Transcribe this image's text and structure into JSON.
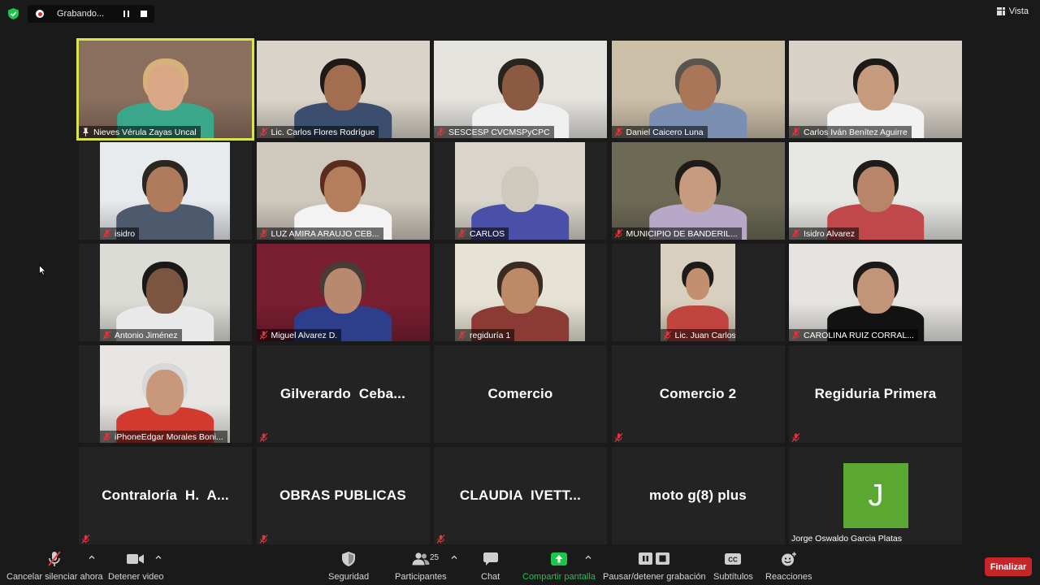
{
  "recording": {
    "label": "Grabando..."
  },
  "view": {
    "label": "Vista"
  },
  "tiles": [
    {
      "name": "Nieves Vérula Zayas Uncal",
      "icon": "pin-icon",
      "bg": "#8a6f5e",
      "skin": "#d9a686",
      "hair": "#d6b27a",
      "shirt": "#3aa68a"
    },
    {
      "name": "Lic. Carlos Flores Rodrígue",
      "icon": "mic-muted-icon",
      "bg": "#d9d3c9",
      "skin": "#a36d4f",
      "hair": "#1d1a18",
      "shirt": "#3b4e6e"
    },
    {
      "name": "SESCESP CVCMSPyCPC",
      "icon": "mic-muted-icon",
      "bg": "#e5e3de",
      "skin": "#8c5a40",
      "hair": "#2a2420",
      "shirt": "#f0f0f0"
    },
    {
      "name": "Daniel Caicero Luna",
      "icon": "mic-muted-icon",
      "bg": "#cbbfa8",
      "skin": "#a97658",
      "hair": "#5a544e",
      "shirt": "#7b8fb2"
    },
    {
      "name": "Carlos Iván Benítez Aguirre",
      "icon": "mic-muted-icon",
      "bg": "#d8d2c8",
      "skin": "#c69a7c",
      "hair": "#1c1a18",
      "shirt": "#f2f2f2"
    },
    {
      "name": "isidro",
      "icon": "mic-muted-icon",
      "bg": "#e8ebee",
      "skin": "#b07a5c",
      "hair": "#2a2622",
      "shirt": "#4d5a6e"
    },
    {
      "name": "LUZ AMIRA ARAUJO CEB...",
      "icon": "mic-muted-icon",
      "bg": "#cfc8bd",
      "skin": "#b47e5d",
      "hair": "#5b2c1e",
      "shirt": "#f3f3f3"
    },
    {
      "name": "CARLOS",
      "icon": "mic-muted-icon",
      "bg": "#d9d5cc",
      "skin": "#cfc9bd",
      "hair": "#d9d5cc",
      "shirt": "#4a4fa8"
    },
    {
      "name": "MUNICIPIO DE BANDERIL...",
      "icon": "mic-muted-icon",
      "bg": "#6c6a55",
      "skin": "#c79b80",
      "hair": "#1f1b18",
      "shirt": "#b8a8c8"
    },
    {
      "name": "Isidro Alvarez",
      "icon": "mic-muted-icon",
      "bg": "#e7e7e4",
      "skin": "#b88568",
      "hair": "#1f1c1a",
      "shirt": "#c0484a"
    },
    {
      "name": "Antonio Jiménez",
      "icon": "mic-muted-icon",
      "bg": "#dcdcd6",
      "skin": "#7c5540",
      "hair": "#1a1818",
      "shirt": "#e9e9e9"
    },
    {
      "name": "Miguel Alvarez D.",
      "icon": "mic-muted-icon",
      "bg": "#7a1e32",
      "skin": "#b8896e",
      "hair": "#4a3b36",
      "shirt": "#2d3f8a"
    },
    {
      "name": "regiduría 1",
      "icon": "mic-muted-icon",
      "bg": "#e6e3d4",
      "skin": "#bd8a66",
      "hair": "#3b2b22",
      "shirt": "#8b3a34"
    },
    {
      "name": "Lic. Juan Carlos Jacome Se...",
      "icon": "mic-muted-icon",
      "bg": "#d9cfbf",
      "skin": "#c2906f",
      "hair": "#1d1b19",
      "shirt": "#c0453f"
    },
    {
      "name": "CAROLINA RUIZ CORRAL...",
      "icon": "mic-muted-icon",
      "bg": "#e5e4e0",
      "skin": "#c39578",
      "hair": "#1c1a18",
      "shirt": "#121212"
    },
    {
      "name": "iPhoneEdgar Morales Boni...",
      "icon": "mic-muted-icon",
      "bg": "#e8e6e2",
      "skin": "#c9977a",
      "hair": "#d8d8d8",
      "shirt": "#d23a30"
    },
    {
      "name": "Gilverardo  Ceba...",
      "icon": "mic-muted-icon"
    },
    {
      "name": "Comercio",
      "icon": ""
    },
    {
      "name": "Comercio 2",
      "icon": "mic-muted-icon"
    },
    {
      "name": "Regiduria Primera",
      "icon": "mic-muted-icon"
    },
    {
      "name": "Contraloría  H.  A...",
      "icon": "mic-muted-icon"
    },
    {
      "name": "OBRAS PUBLICAS",
      "icon": "mic-muted-icon"
    },
    {
      "name": "CLAUDIA  IVETT...",
      "icon": "mic-muted-icon"
    },
    {
      "name": "moto g(8) plus",
      "icon": ""
    },
    {
      "name": "Jorge Oswaldo Garcia Platas",
      "avatar_letter": "J",
      "avatar_color": "#5aa832",
      "icon": ""
    }
  ],
  "toolbar": {
    "unmute": "Cancelar silenciar ahora",
    "video": "Detener video",
    "security": "Seguridad",
    "participants": "Participantes",
    "participants_count": "25",
    "chat": "Chat",
    "share": "Compartir pantalla",
    "record": "Pausar/detener grabación",
    "captions": "Subtítulos",
    "reactions": "Reacciones",
    "end": "Finalizar"
  },
  "colors": {
    "accent_green": "#1ec34c",
    "end_red": "#c7252a",
    "active_speaker": "#d9e34a",
    "mute_red": "#e0353a"
  }
}
